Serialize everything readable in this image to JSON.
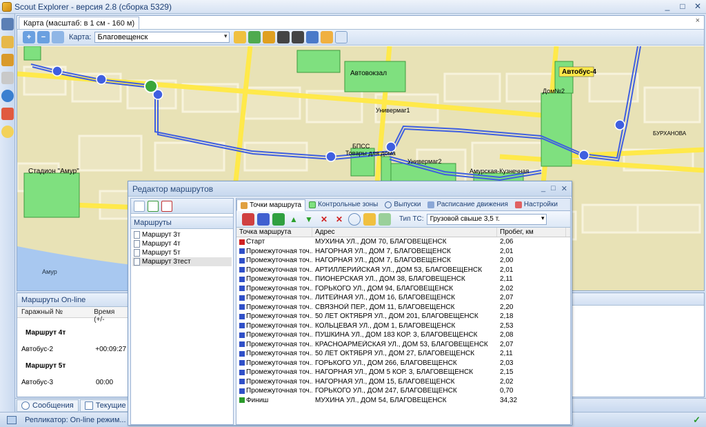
{
  "window": {
    "title": "Scout Explorer - версия 2.8 (сборка 5329)",
    "controls": {
      "minimize": "_",
      "maximize": "□",
      "close": "✕"
    }
  },
  "map_panel": {
    "tab_label": "Карта (масштаб: в 1 см - 160 м)",
    "close": "×",
    "map_label": "Карта:",
    "map_value": "Благовещенск",
    "labels": {
      "stadium": "Стадион \"Амур\"",
      "bus_station": "Автовокзал",
      "bus4": "Автобус-4",
      "univermag1": "Универмаг1",
      "univermag2": "Универмаг2",
      "amur_kuz": "Амурская-Кузнечная",
      "bpss": "БПСС",
      "tovary": "Товары для дома",
      "dom": "Дом№2",
      "river": "Амур",
      "burkhanova": "БУРХАНОВА"
    }
  },
  "online_panel": {
    "title": "Маршруты On-line",
    "col_garage": "Гаражный №",
    "col_time": "Время (+/-",
    "rows": [
      {
        "type": "group",
        "name": "Маршрут 4т"
      },
      {
        "type": "item",
        "name": "Автобус-2",
        "time": "+00:09:27"
      },
      {
        "type": "group",
        "name": "Маршрут 5т"
      },
      {
        "type": "item",
        "name": "Автобус-3",
        "time": "00:00"
      }
    ]
  },
  "bottom_tabs": [
    {
      "label": "Сообщения"
    },
    {
      "label": "Текущие данн"
    }
  ],
  "status": {
    "text": "Репликатор: On-line режим...",
    "check": "✓"
  },
  "dialog": {
    "title": "Редактор маршрутов",
    "controls": {
      "minimize": "_",
      "maximize": "□",
      "close": "✕"
    },
    "routes_header": "Маршруты",
    "routes": [
      "Маршрут 3т",
      "Маршрут 4т",
      "Маршрут 5т",
      "Маршрут 3тест"
    ],
    "tabs": [
      "Точки маршрута",
      "Контрольные зоны",
      "Выпуски",
      "Расписание движения",
      "Настройки"
    ],
    "tc_label": "Тип ТС:",
    "tc_value": "Грузовой свыше 3,5 т.",
    "columns": [
      "Точка маршрута",
      "Адрес",
      "Пробег, км"
    ],
    "rows": [
      {
        "point": "Старт",
        "flag": "start",
        "address": "МУХИНА УЛ., ДОМ 70, БЛАГОВЕЩЕНСК",
        "km": "2,06"
      },
      {
        "point": "Промежуточная точ...",
        "flag": "mid",
        "address": "НАГОРНАЯ УЛ., ДОМ 7, БЛАГОВЕЩЕНСК",
        "km": "2,01"
      },
      {
        "point": "Промежуточная точ...",
        "flag": "mid",
        "address": "НАГОРНАЯ УЛ., ДОМ 7, БЛАГОВЕЩЕНСК",
        "km": "2,00"
      },
      {
        "point": "Промежуточная точ...",
        "flag": "mid",
        "address": "АРТИЛЛЕРИЙСКАЯ УЛ., ДОМ 53, БЛАГОВЕЩЕНСК",
        "km": "2,01"
      },
      {
        "point": "Промежуточная точ...",
        "flag": "mid",
        "address": "ПИОНЕРСКАЯ УЛ., ДОМ 38, БЛАГОВЕЩЕНСК",
        "km": "2,11"
      },
      {
        "point": "Промежуточная точ...",
        "flag": "mid",
        "address": "ГОРЬКОГО УЛ., ДОМ 94, БЛАГОВЕЩЕНСК",
        "km": "2,02"
      },
      {
        "point": "Промежуточная точ...",
        "flag": "mid",
        "address": "ЛИТЕЙНАЯ УЛ., ДОМ 16, БЛАГОВЕЩЕНСК",
        "km": "2,07"
      },
      {
        "point": "Промежуточная точ...",
        "flag": "mid",
        "address": "СВЯЗНОЙ ПЕР., ДОМ 11, БЛАГОВЕЩЕНСК",
        "km": "2,20"
      },
      {
        "point": "Промежуточная точ...",
        "flag": "mid",
        "address": "50 ЛЕТ ОКТЯБРЯ УЛ., ДОМ 201, БЛАГОВЕЩЕНСК",
        "km": "2,18"
      },
      {
        "point": "Промежуточная точ...",
        "flag": "mid",
        "address": "КОЛЬЦЕВАЯ УЛ., ДОМ 1, БЛАГОВЕЩЕНСК",
        "km": "2,53"
      },
      {
        "point": "Промежуточная точ...",
        "flag": "mid",
        "address": "ПУШКИНА УЛ., ДОМ 183 КОР. 3, БЛАГОВЕЩЕНСК",
        "km": "2,08"
      },
      {
        "point": "Промежуточная точ...",
        "flag": "mid",
        "address": "КРАСНОАРМЕЙСКАЯ УЛ., ДОМ 53, БЛАГОВЕЩЕНСК",
        "km": "2,07"
      },
      {
        "point": "Промежуточная точ...",
        "flag": "mid",
        "address": "50 ЛЕТ ОКТЯБРЯ УЛ., ДОМ 27, БЛАГОВЕЩЕНСК",
        "km": "2,11"
      },
      {
        "point": "Промежуточная точ...",
        "flag": "mid",
        "address": "ГОРЬКОГО УЛ., ДОМ 266, БЛАГОВЕЩЕНСК",
        "km": "2,03"
      },
      {
        "point": "Промежуточная точ...",
        "flag": "mid",
        "address": "НАГОРНАЯ УЛ., ДОМ 5 КОР. 3, БЛАГОВЕЩЕНСК",
        "km": "2,15"
      },
      {
        "point": "Промежуточная точ...",
        "flag": "mid",
        "address": "НАГОРНАЯ УЛ., ДОМ 15, БЛАГОВЕЩЕНСК",
        "km": "2,02"
      },
      {
        "point": "Промежуточная точ...",
        "flag": "mid",
        "address": "ГОРЬКОГО УЛ., ДОМ 247, БЛАГОВЕЩЕНСК",
        "km": "0,70"
      },
      {
        "point": "Финиш",
        "flag": "finish",
        "address": "МУХИНА УЛ., ДОМ 54, БЛАГОВЕЩЕНСК",
        "km": "34,32"
      }
    ]
  },
  "colors": {
    "route_line": "#3f5fe0",
    "zone_fill": "#7fe07f",
    "yellow_street": "#ffe94a",
    "flag_start": "#d02020",
    "flag_mid": "#3050c8",
    "flag_finish": "#2a9a2a"
  }
}
